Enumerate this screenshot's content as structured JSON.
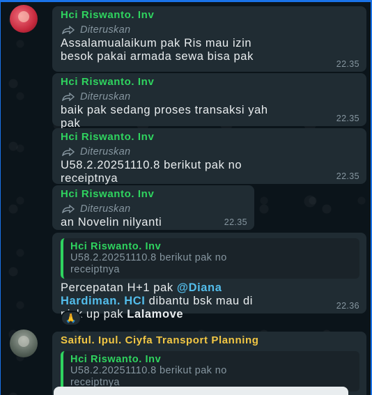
{
  "messages": [
    {
      "sender": "Hci Riswanto. Inv",
      "forwarded_label": "Diteruskan",
      "text": "Assalamualaikum pak Ris mau izin\nbesok pakai armada sewa bisa pak",
      "time": "22.35"
    },
    {
      "sender": "Hci Riswanto. Inv",
      "forwarded_label": "Diteruskan",
      "text": "baik pak sedang proses transaksi yah\npak",
      "time": "22.35"
    },
    {
      "sender": "Hci Riswanto. Inv",
      "forwarded_label": "Diteruskan",
      "text": "U58.2.20251110.8 berikut pak no\nreceiptnya",
      "time": "22.35"
    },
    {
      "sender": "Hci Riswanto. Inv",
      "forwarded_label": "Diteruskan",
      "text": "an Novelin nilyanti",
      "time": "22.35"
    }
  ],
  "reply_message": {
    "quote_name": "Hci Riswanto. Inv",
    "quote_text": "U58.2.20251110.8 berikut pak no\nreceiptnya",
    "text_before": "Percepatan H+1 pak ",
    "mention": "@Diana\nHardiman. HCI",
    "text_middle": " dibantu bsk mau di\npick up pak ",
    "bold_text": "Lalamove",
    "time": "22.36",
    "reaction": "🙏"
  },
  "last_message": {
    "sender": "Saiful. Ipul. Ciyfa Transport Planning",
    "quote_name": "Hci Riswanto. Inv",
    "quote_text": "U58.2.20251110.8 berikut pak no\nreceiptnya"
  },
  "colors": {
    "background": "#0b141a",
    "bubble": "#202c33",
    "sender_green": "#2fd45f",
    "sender_yellow": "#f2c744",
    "mention_blue": "#53bdeb",
    "meta_gray": "#8696a0"
  },
  "icons": [
    "forward-icon",
    "avatar",
    "pray-emoji"
  ]
}
